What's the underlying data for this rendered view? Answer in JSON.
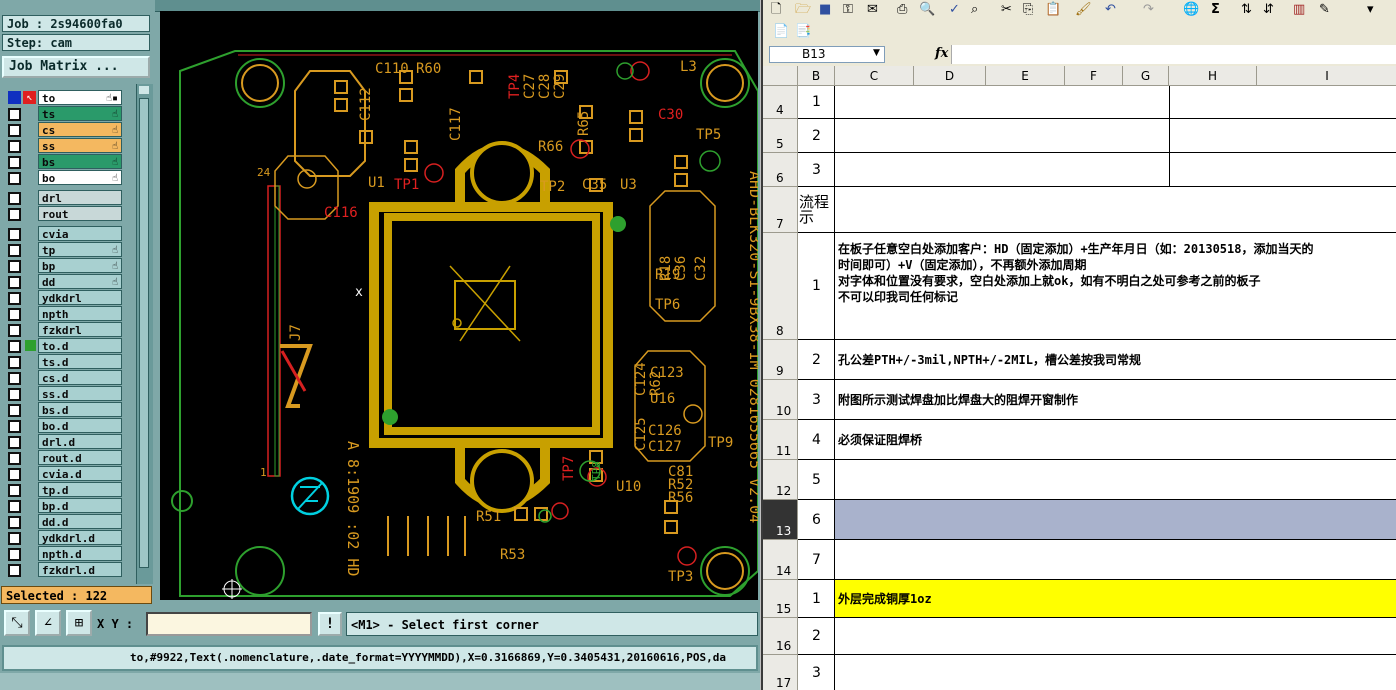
{
  "cam": {
    "job": "Job : 2s94600fa0",
    "step": "Step: cam",
    "job_matrix": "Job Matrix ...",
    "layers": [
      {
        "name": "to",
        "color": "#ffffff",
        "mark": "☝▪"
      },
      {
        "name": "ts",
        "color": "#2a9a6a",
        "mark": "☝"
      },
      {
        "name": "cs",
        "color": "#f4b860",
        "mark": "☝"
      },
      {
        "name": "ss",
        "color": "#f4b860",
        "mark": "☝"
      },
      {
        "name": "bs",
        "color": "#2a9a6a",
        "mark": "☝"
      },
      {
        "name": "bo",
        "color": "#ffffff",
        "mark": "☝"
      },
      {
        "name": "drl",
        "color": "#c8d8d8",
        "mark": ""
      },
      {
        "name": "rout",
        "color": "#c8d8d8",
        "mark": ""
      },
      {
        "name": "cvia",
        "color": "#a8d0d0",
        "mark": ""
      },
      {
        "name": "tp",
        "color": "#a8d0d0",
        "mark": "☝"
      },
      {
        "name": "bp",
        "color": "#a8d0d0",
        "mark": "☝"
      },
      {
        "name": "dd",
        "color": "#a8d0d0",
        "mark": "☝"
      },
      {
        "name": "ydkdrl",
        "color": "#a8d0d0",
        "mark": ""
      },
      {
        "name": "npth",
        "color": "#a8d0d0",
        "mark": ""
      },
      {
        "name": "fzkdrl",
        "color": "#a8d0d0",
        "mark": ""
      },
      {
        "name": "to.d",
        "color": "#a8d0d0",
        "mark": ""
      },
      {
        "name": "ts.d",
        "color": "#a8d0d0",
        "mark": ""
      },
      {
        "name": "cs.d",
        "color": "#a8d0d0",
        "mark": ""
      },
      {
        "name": "ss.d",
        "color": "#a8d0d0",
        "mark": ""
      },
      {
        "name": "bs.d",
        "color": "#a8d0d0",
        "mark": ""
      },
      {
        "name": "bo.d",
        "color": "#a8d0d0",
        "mark": ""
      },
      {
        "name": "drl.d",
        "color": "#a8d0d0",
        "mark": ""
      },
      {
        "name": "rout.d",
        "color": "#a8d0d0",
        "mark": ""
      },
      {
        "name": "cvia.d",
        "color": "#a8d0d0",
        "mark": ""
      },
      {
        "name": "tp.d",
        "color": "#a8d0d0",
        "mark": ""
      },
      {
        "name": "bp.d",
        "color": "#a8d0d0",
        "mark": ""
      },
      {
        "name": "dd.d",
        "color": "#a8d0d0",
        "mark": ""
      },
      {
        "name": "ydkdrl.d",
        "color": "#a8d0d0",
        "mark": ""
      },
      {
        "name": "npth.d",
        "color": "#a8d0d0",
        "mark": ""
      },
      {
        "name": "fzkdrl.d",
        "color": "#a8d0d0",
        "mark": ""
      }
    ],
    "selected": "Selected : 122",
    "xy_label": "X Y :",
    "xy_value": "",
    "prompt_button": "!",
    "prompt": "<M1> - Select first corner",
    "status": "to,#9922,Text(.nomenclature,.date_format=YYYYMMDD),X=0.3166869,Y=0.3405431,20160616,POS,da",
    "board_labels": {
      "c110": "C110",
      "r60": "R60",
      "tp4": "TP4",
      "c27": "C27",
      "c28": "C28",
      "c29": "C29",
      "l3": "L3",
      "c112": "C112",
      "c117": "C117",
      "r65": "R65",
      "c30": "C30",
      "tp5": "TP5",
      "r66": "R66",
      "tp2": "TP2",
      "c35": "C35",
      "u3": "U3",
      "u1": "U1",
      "tp1": "TP1",
      "c116": "C116",
      "num24": "24",
      "r18": "R18",
      "c36": "C36",
      "c32": "C32",
      "r19": "R19",
      "tp6": "TP6",
      "vertical_text": "AHD-BLK320-SI-9BX38-IM  0281655665 V2.04",
      "j7": "J7",
      "c123": "C123",
      "r62": "R62",
      "c124": "C124",
      "u16": "U16",
      "c125": "C125",
      "c126": "C126",
      "c127": "C127",
      "tp9": "TP9",
      "tp7": "TP7",
      "tp8": "TP8",
      "u10": "U10",
      "c81": "C81",
      "r52": "R52",
      "r56": "R56",
      "r51": "R51",
      "r53": "R53",
      "tp3": "TP3",
      "num1": "1",
      "date_text": "A 8:1909 :02 HD",
      "cursor_x": "x"
    }
  },
  "excel": {
    "namebox": "B13",
    "fx": "fx",
    "formula": "",
    "columns": [
      "B",
      "C",
      "D",
      "E",
      "F",
      "G",
      "H",
      "I"
    ],
    "rows": [
      {
        "num": "4",
        "b": "1",
        "text": "",
        "split": true
      },
      {
        "num": "5",
        "b": "2",
        "text": "",
        "split": true
      },
      {
        "num": "6",
        "b": "3",
        "text": "",
        "split": true
      },
      {
        "num": "7",
        "b": "流程\n示",
        "text": "",
        "split": false
      },
      {
        "num": "8",
        "b": "1",
        "text": "在板子任意空白处添加客户：HD（固定添加）+生产年月日（如：20130518，添加当天的\n时间即可）+V（固定添加），不再额外添加周期\n对字体和位置没有要求，空白处添加上就ok，如有不明白之处可参考之前的板子\n不可以印我司任何标记",
        "split": false
      },
      {
        "num": "9",
        "b": "2",
        "text": "孔公差PTH+/-3mil,NPTH+/-2MIL，槽公差按我司常规",
        "split": false
      },
      {
        "num": "10",
        "b": "3",
        "text": "附图所示测试焊盘加比焊盘大的阻焊开窗制作",
        "split": false
      },
      {
        "num": "11",
        "b": "4",
        "text": "必须保证阻焊桥",
        "split": false
      },
      {
        "num": "12",
        "b": "5",
        "text": "",
        "split": false
      },
      {
        "num": "13",
        "b": "6",
        "text": "",
        "split": false
      },
      {
        "num": "14",
        "b": "7",
        "text": "",
        "split": false
      },
      {
        "num": "15",
        "b": "1",
        "text": "外层完成铜厚1oz",
        "split": false
      },
      {
        "num": "16",
        "b": "2",
        "text": "",
        "split": false
      },
      {
        "num": "17",
        "b": "3",
        "text": "",
        "split": false
      }
    ],
    "highlight_color": "#ffff00",
    "selected_row_color": "#a9b2cc"
  }
}
